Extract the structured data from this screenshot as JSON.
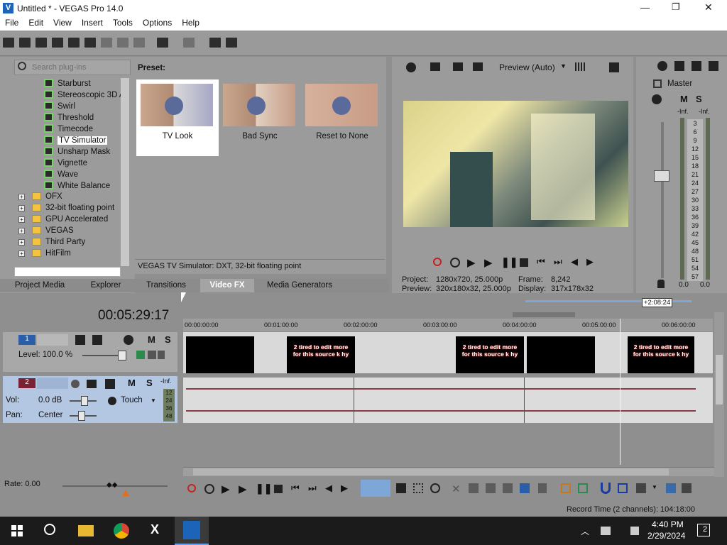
{
  "window": {
    "title": "Untitled * - VEGAS Pro 14.0",
    "minimize": "—",
    "maximize": "❐",
    "close": "✕"
  },
  "menu": [
    "File",
    "Edit",
    "View",
    "Insert",
    "Tools",
    "Options",
    "Help"
  ],
  "plugins": {
    "search_placeholder": "Search plug-ins",
    "fx_items": [
      "Starburst",
      "Stereoscopic 3D A",
      "Swirl",
      "Threshold",
      "Timecode",
      "TV Simulator",
      "Unsharp Mask",
      "Vignette",
      "Wave",
      "White Balance"
    ],
    "selected": "TV Simulator",
    "folders": [
      "OFX",
      "32-bit floating point",
      "GPU Accelerated",
      "VEGAS",
      "Third Party",
      "HitFilm"
    ]
  },
  "presets": {
    "label": "Preset:",
    "items": [
      "TV Look",
      "Bad Sync",
      "Reset to None"
    ],
    "status": "VEGAS TV Simulator: DXT, 32-bit floating point"
  },
  "tabs": [
    "Project Media",
    "Explorer",
    "Transitions",
    "Video FX",
    "Media Generators"
  ],
  "active_tab": "Video FX",
  "preview": {
    "mode": "Preview (Auto)",
    "project_label": "Project:",
    "project_value": "1280x720, 25.000p",
    "preview_label": "Preview:",
    "preview_value": "320x180x32, 25.000p",
    "frame_label": "Frame:",
    "frame_value": "8,242",
    "display_label": "Display:",
    "display_value": "317x178x32"
  },
  "master": {
    "label": "Master",
    "m": "M",
    "s": "S",
    "inf_left": "-Inf.",
    "inf_right": "-Inf.",
    "scale": [
      "3",
      "6",
      "9",
      "12",
      "15",
      "18",
      "21",
      "24",
      "27",
      "30",
      "33",
      "36",
      "39",
      "42",
      "45",
      "48",
      "51",
      "54",
      "57"
    ],
    "level_left": "0.0",
    "level_right": "0.0"
  },
  "timeline": {
    "timecode": "00:05:29:17",
    "loop_duration": "+2:08:24",
    "ruler": [
      "00:00:00:00",
      "00:01:00:00",
      "00:02:00:00",
      "00:03:00:00",
      "00:04:00:00",
      "00:05:00:00",
      "00:06:00:00"
    ],
    "clip_text": "2 tired to edit more for this source k hy",
    "rate": "Rate: 0.00",
    "record_time": "Record Time (2 channels): 104:18:00"
  },
  "track1": {
    "number": "1",
    "level": "Level: 100.0 %",
    "m": "M",
    "s": "S"
  },
  "track2": {
    "number": "2",
    "vol_label": "Vol:",
    "vol_value": "0.0 dB",
    "pan_label": "Pan:",
    "pan_value": "Center",
    "mode": "Touch",
    "m": "M",
    "s": "S",
    "inf": "-Inf.",
    "meter": [
      "12",
      "24",
      "36",
      "48"
    ]
  },
  "taskbar": {
    "time": "4:40 PM",
    "date": "2/29/2024",
    "notifications": "2"
  },
  "colors": {
    "panel": "#9b9b9b",
    "track_header": "#b3c6e2",
    "accent": "#1a72c7",
    "taskbar": "#1b1b1b"
  }
}
